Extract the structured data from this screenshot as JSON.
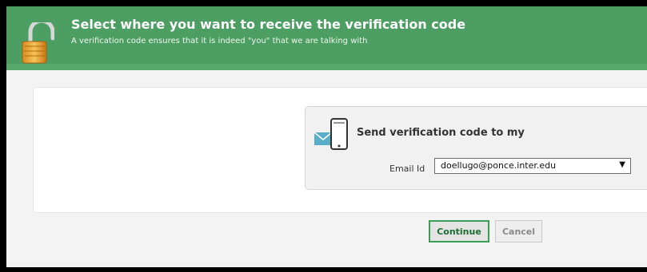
{
  "header": {
    "title": "Select where you want to receive the verification code",
    "subtitle": "A verification code ensures that it is indeed \"you\" that we are talking with",
    "icon": "padlock-open-icon",
    "accent_color": "#4d9e63"
  },
  "verification": {
    "icon": "phone-email-icon",
    "heading": "Send verification code to my",
    "field_label": "Email Id",
    "selected_option": "doellugo@ponce.inter.edu"
  },
  "actions": {
    "continue_label": "Continue",
    "cancel_label": "Cancel"
  }
}
